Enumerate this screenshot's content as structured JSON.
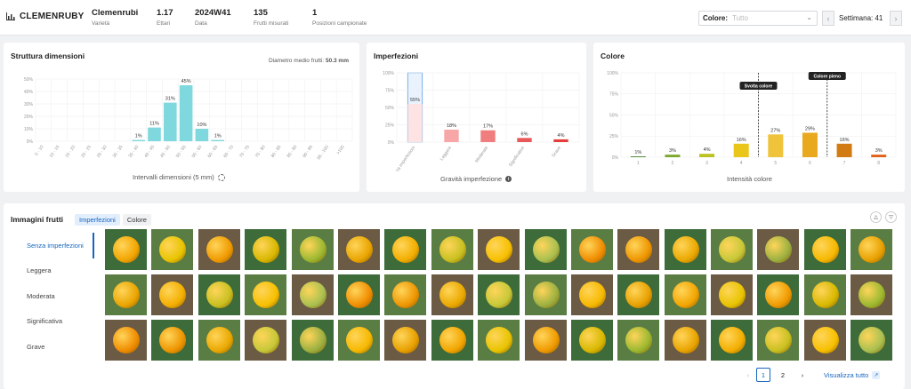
{
  "header": {
    "product": "CLEMENRUBY",
    "fields": [
      {
        "value": "Clemenrubi",
        "label": "Varietà"
      },
      {
        "value": "1.17",
        "label": "Ettari"
      },
      {
        "value": "2024W41",
        "label": "Data"
      },
      {
        "value": "135",
        "label": "Frutti misurati"
      },
      {
        "value": "1",
        "label": "Posizioni campionate"
      }
    ],
    "color_select": {
      "label": "Colore:",
      "placeholder": "Tutto"
    },
    "week_label": "Settimana: 41"
  },
  "size_card": {
    "title": "Struttura dimensioni",
    "avg_label": "Diametro medio frutti:",
    "avg_value": "50.3 mm",
    "caption": "Intervalli dimensioni (5 mm)"
  },
  "imperf_card": {
    "title": "Imperfezioni",
    "caption": "Gravità imperfezione"
  },
  "color_card": {
    "title": "Colore",
    "caption": "Intensità colore",
    "markers": [
      "Svolta colore",
      "Colore pieno"
    ]
  },
  "chart_data": [
    {
      "type": "bar",
      "title": "Struttura dimensioni",
      "xlabel": "Intervalli dimensioni (5 mm)",
      "ylim": [
        0,
        50
      ],
      "yticks": [
        "0%",
        "10%",
        "20%",
        "30%",
        "40%",
        "50%"
      ],
      "categories": [
        "0 - 10",
        "10 - 15",
        "15 - 20",
        "20 - 25",
        "25 - 30",
        "30 - 35",
        "35 - 40",
        "40 - 45",
        "45 - 50",
        "50 - 55",
        "55 - 60",
        "60 - 65",
        "65 - 70",
        "70 - 75",
        "75 - 80",
        "80 - 85",
        "85 - 90",
        "90 - 95",
        "95 - 100",
        ">100"
      ],
      "values": [
        0,
        0,
        0,
        0,
        0,
        0,
        1,
        11,
        31,
        45,
        10,
        1,
        0,
        0,
        0,
        0,
        0,
        0,
        0,
        0
      ],
      "labels": [
        "",
        "",
        "",
        "",
        "",
        "",
        "1%",
        "11%",
        "31%",
        "45%",
        "10%",
        "1%",
        "",
        "",
        "",
        "",
        "",
        "",
        "",
        ""
      ],
      "color": "#7fd8de"
    },
    {
      "type": "bar",
      "title": "Imperfezioni",
      "xlabel": "Gravità imperfezione",
      "ylim": [
        0,
        100
      ],
      "yticks": [
        "0%",
        "25%",
        "50%",
        "75%",
        "100%"
      ],
      "categories": [
        "Senza imperfezioni",
        "Leggere",
        "Moderate",
        "Significative",
        "Grave"
      ],
      "values": [
        55,
        18,
        17,
        6,
        4
      ],
      "labels": [
        "55%",
        "18%",
        "17%",
        "6%",
        "4%"
      ],
      "colors": [
        "#fde3e3",
        "#f7a7a7",
        "#f07e7e",
        "#ea5959",
        "#e63c3c"
      ]
    },
    {
      "type": "bar",
      "title": "Colore",
      "xlabel": "Intensità colore",
      "ylim": [
        0,
        100
      ],
      "yticks": [
        "0%",
        "25%",
        "50%",
        "75%",
        "100%"
      ],
      "categories": [
        "1",
        "2",
        "3",
        "4",
        "5",
        "6",
        "7",
        "8"
      ],
      "values": [
        1,
        3,
        4,
        16,
        27,
        29,
        16,
        3
      ],
      "labels": [
        "1%",
        "3%",
        "4%",
        "16%",
        "27%",
        "29%",
        "16%",
        "3%"
      ],
      "colors": [
        "#4e8a36",
        "#7aa82c",
        "#bcc220",
        "#ebc61a",
        "#f0c43a",
        "#e8a91e",
        "#d27b12",
        "#e06018"
      ]
    }
  ],
  "images": {
    "title": "Imperfezioni",
    "section_title": "Immagini frutti",
    "tabs": [
      "Imperfezioni",
      "Colore"
    ],
    "categories": [
      "Senza imperfezioni",
      "Leggera",
      "Moderata",
      "Significativa",
      "Grave"
    ],
    "feedback": [
      "thumbs-up-icon",
      "thumbs-down-icon"
    ]
  },
  "pagination": {
    "pages": [
      "1",
      "2"
    ],
    "current": "1",
    "view_all": "Visualizza tutto"
  }
}
